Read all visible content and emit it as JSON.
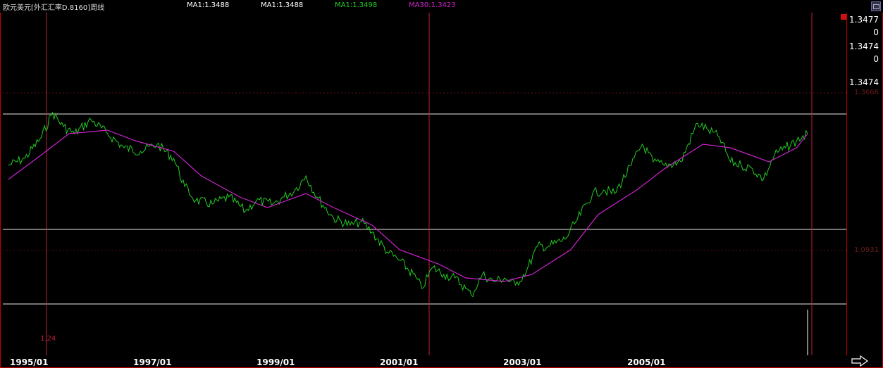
{
  "header": {
    "title": "欧元美元[外汇汇率D.8160]周线",
    "ma_labels": [
      {
        "text": "MA1:1.3488",
        "color": "#ffffff"
      },
      {
        "text": "MA1:1.3488",
        "color": "#ffffff"
      },
      {
        "text": "MA1:1.3498",
        "color": "#22cc22"
      },
      {
        "text": "MA30:1.3423",
        "color": "#cc22cc"
      }
    ]
  },
  "y_axis": {
    "labels": [
      "1.3477",
      "0",
      "1.3474",
      "0",
      "1.3474"
    ],
    "faint_labels": [
      "1.3666",
      "1.0931"
    ]
  },
  "x_axis": {
    "labels": [
      "1995/01",
      "1997/01",
      "1999/01",
      "2001/01",
      "2003/01",
      "2005/01"
    ]
  },
  "marker_label": "1.24",
  "chart_data": {
    "type": "line",
    "title": "欧元美元[外汇汇率D.8160]周线",
    "x_range": [
      "1994/06",
      "2006/08"
    ],
    "ylim": [
      0.8,
      1.42
    ],
    "series": [
      {
        "name": "MA1",
        "color": "#22cc22",
        "x": [
          "1994/07",
          "1994/10",
          "1995/01",
          "1995/03",
          "1995/05",
          "1995/07",
          "1995/10",
          "1996/01",
          "1996/04",
          "1996/07",
          "1996/10",
          "1997/01",
          "1997/03",
          "1997/05",
          "1997/08",
          "1997/11",
          "1998/02",
          "1998/04",
          "1998/07",
          "1998/09",
          "1998/11",
          "1999/01",
          "1999/03",
          "1999/06",
          "1999/09",
          "1999/11",
          "2000/01",
          "2000/04",
          "2000/06",
          "2000/09",
          "2000/10",
          "2000/12",
          "2001/02",
          "2001/04",
          "2001/06",
          "2001/07",
          "2001/09",
          "2001/11",
          "2002/01",
          "2002/03",
          "2002/05",
          "2002/07",
          "2002/09",
          "2002/12",
          "2003/02",
          "2003/05",
          "2003/07",
          "2003/09",
          "2003/12",
          "2004/02",
          "2004/04",
          "2004/06",
          "2004/09",
          "2004/12",
          "2005/02",
          "2005/04",
          "2005/06",
          "2005/08",
          "2005/10",
          "2005/12",
          "2006/02",
          "2006/04",
          "2006/06",
          "2006/08"
        ],
        "values": [
          1.21,
          1.23,
          1.29,
          1.36,
          1.32,
          1.3,
          1.34,
          1.3,
          1.26,
          1.25,
          1.27,
          1.23,
          1.15,
          1.11,
          1.1,
          1.12,
          1.08,
          1.11,
          1.1,
          1.12,
          1.14,
          1.18,
          1.12,
          1.06,
          1.04,
          1.05,
          1.02,
          0.96,
          0.94,
          0.89,
          0.86,
          0.92,
          0.9,
          0.89,
          0.86,
          0.84,
          0.9,
          0.88,
          0.89,
          0.87,
          0.91,
          0.98,
          0.98,
          1.0,
          1.05,
          1.13,
          1.14,
          1.13,
          1.21,
          1.27,
          1.22,
          1.21,
          1.22,
          1.33,
          1.31,
          1.29,
          1.22,
          1.21,
          1.2,
          1.17,
          1.24,
          1.26,
          1.28,
          1.3
        ]
      },
      {
        "name": "MA30",
        "color": "#cc22cc",
        "x": [
          "1994/07",
          "1995/01",
          "1995/06",
          "1996/01",
          "1996/06",
          "1997/01",
          "1997/06",
          "1998/01",
          "1998/06",
          "1999/01",
          "1999/06",
          "2000/01",
          "2000/06",
          "2001/01",
          "2001/06",
          "2002/01",
          "2002/06",
          "2003/01",
          "2003/06",
          "2004/01",
          "2004/06",
          "2005/01",
          "2005/06",
          "2006/01",
          "2006/06",
          "2006/08"
        ],
        "values": [
          1.17,
          1.24,
          1.3,
          1.31,
          1.28,
          1.25,
          1.18,
          1.12,
          1.09,
          1.13,
          1.09,
          1.04,
          0.97,
          0.93,
          0.89,
          0.88,
          0.9,
          0.97,
          1.07,
          1.14,
          1.2,
          1.27,
          1.26,
          1.22,
          1.26,
          1.3
        ]
      }
    ]
  }
}
